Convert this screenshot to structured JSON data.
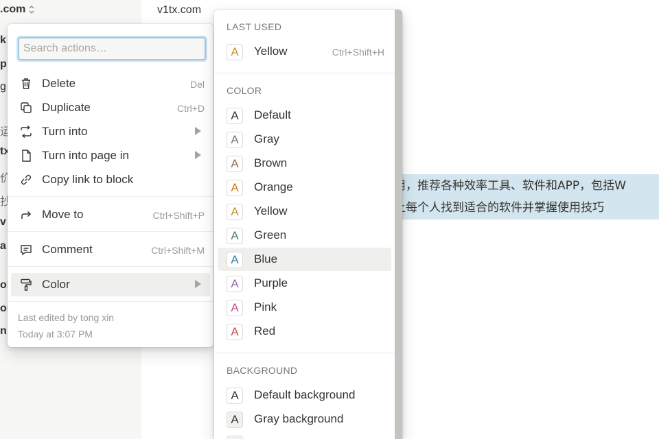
{
  "workspace": {
    "name": ".com"
  },
  "breadcrumb": "v1tx.com",
  "sidebar_fragments": [
    "k",
    "p",
    "g",
    "运",
    "tx",
    "价",
    "抄",
    "v",
    "a",
    "ol",
    "or",
    "n"
  ],
  "page_text": {
    "line1": "用，推荐各种效率工具、软件和APP，包括W",
    "line2": "让每个人找到适合的软件并掌握使用技巧"
  },
  "action_menu": {
    "search_placeholder": "Search actions…",
    "items": [
      {
        "label": "Delete",
        "shortcut": "Del",
        "icon": "trash-icon"
      },
      {
        "label": "Duplicate",
        "shortcut": "Ctrl+D",
        "icon": "duplicate-icon"
      },
      {
        "label": "Turn into",
        "shortcut": "",
        "icon": "turn-into-icon",
        "submenu": true
      },
      {
        "label": "Turn into page in",
        "shortcut": "",
        "icon": "page-icon",
        "submenu": true
      },
      {
        "label": "Copy link to block",
        "shortcut": "",
        "icon": "link-icon"
      },
      {
        "label": "Move to",
        "shortcut": "Ctrl+Shift+P",
        "icon": "move-arrow-icon"
      },
      {
        "label": "Comment",
        "shortcut": "Ctrl+Shift+M",
        "icon": "comment-icon"
      },
      {
        "label": "Color",
        "shortcut": "",
        "icon": "paint-roller-icon",
        "submenu": true,
        "active": true
      }
    ],
    "footer": {
      "edited_by": "Last edited by tong xin",
      "edited_time": "Today at 3:07 PM"
    }
  },
  "color_menu": {
    "last_used_title": "LAST USED",
    "last_used": {
      "label": "Yellow",
      "shortcut": "Ctrl+Shift+H",
      "color": "#cb912f"
    },
    "color_title": "COLOR",
    "colors": [
      {
        "label": "Default",
        "color": "#37352f"
      },
      {
        "label": "Gray",
        "color": "#787774"
      },
      {
        "label": "Brown",
        "color": "#9f6b53"
      },
      {
        "label": "Orange",
        "color": "#d9730d"
      },
      {
        "label": "Yellow",
        "color": "#cb912f"
      },
      {
        "label": "Green",
        "color": "#448361"
      },
      {
        "label": "Blue",
        "color": "#337ea9",
        "hover": true
      },
      {
        "label": "Purple",
        "color": "#9065b0"
      },
      {
        "label": "Pink",
        "color": "#c14c8a"
      },
      {
        "label": "Red",
        "color": "#d44c47"
      }
    ],
    "background_title": "BACKGROUND",
    "backgrounds": [
      {
        "label": "Default background",
        "bg": "#ffffff"
      },
      {
        "label": "Gray background",
        "bg": "#f1f1ef"
      }
    ]
  },
  "swatch_letter": "A"
}
